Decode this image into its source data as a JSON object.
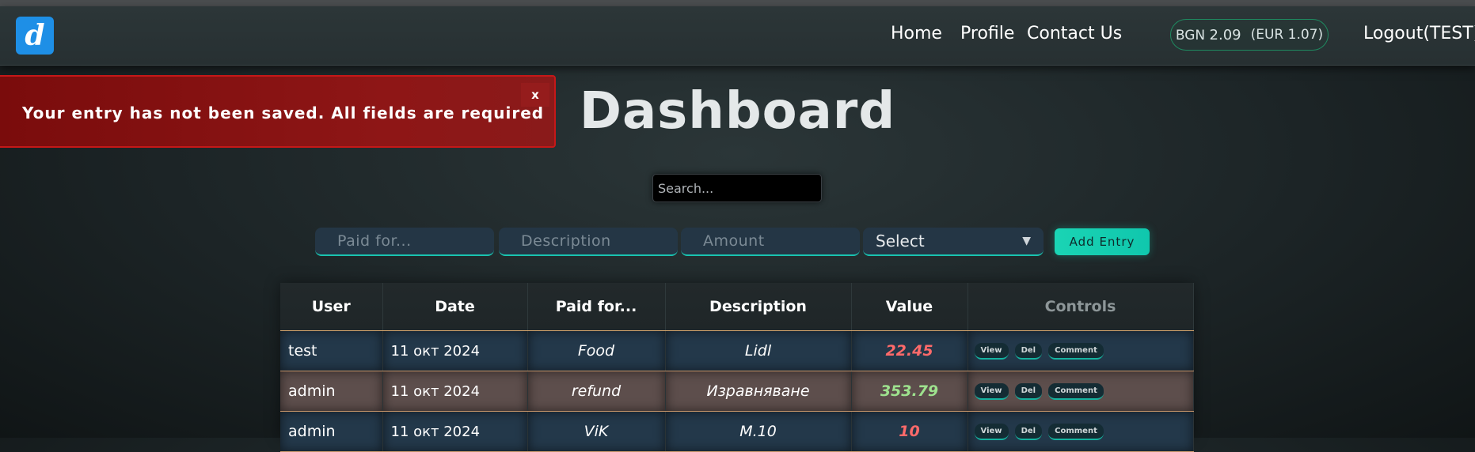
{
  "brand": {
    "logo_letter": "d"
  },
  "nav": {
    "home": "Home",
    "profile": "Profile",
    "contact": "Contact Us",
    "currency": {
      "bgn_label": "BGN",
      "bgn_value": "2.09",
      "eur_text": "(EUR 1.07)"
    },
    "logout": "Logout(TEST)"
  },
  "alert": {
    "message": "Your entry has not been saved. All fields are required",
    "close_label": "x"
  },
  "page_title": "Dashboard",
  "search": {
    "placeholder": "Search..."
  },
  "form": {
    "paid_for_placeholder": "Paid for...",
    "description_placeholder": "Description",
    "amount_placeholder": "Amount",
    "select_value": "Select",
    "add_button": "Add Entry"
  },
  "table": {
    "headers": [
      "User",
      "Date",
      "Paid for...",
      "Description",
      "Value",
      "Controls"
    ],
    "control_labels": {
      "view": "View",
      "del": "Del",
      "comment": "Comment"
    },
    "rows": [
      {
        "user": "test",
        "date": "11 окт 2024",
        "paid_for": "Food",
        "description": "Lidl",
        "value": "22.45"
      },
      {
        "user": "admin",
        "date": "11 окт 2024",
        "paid_for": "refund",
        "description": "Изравняване",
        "value": "353.79"
      },
      {
        "user": "admin",
        "date": "11 окт 2024",
        "paid_for": "ViK",
        "description": "M.10",
        "value": "10"
      }
    ]
  },
  "colors": {
    "accent": "#19c3b0",
    "alert_bg": "#8e1616",
    "value_negative": "#ff6a6a",
    "value_positive": "#9ee28e"
  }
}
